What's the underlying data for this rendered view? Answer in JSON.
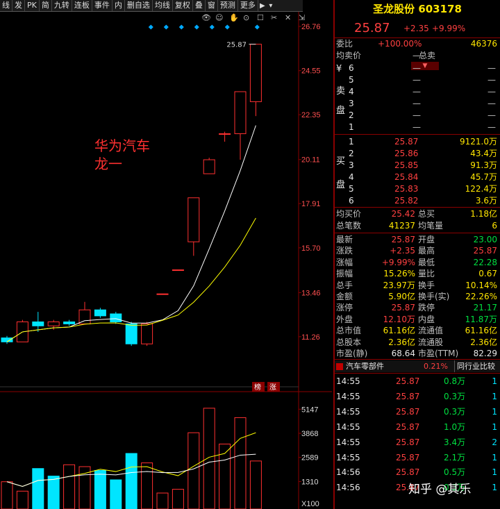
{
  "toolbar": {
    "items": [
      "线",
      "发",
      "PK",
      "简",
      "九转",
      "连板",
      "事件",
      "内",
      "删自选",
      "均线",
      "复权",
      "叠",
      "窗",
      "预测",
      "更多"
    ]
  },
  "annotation": {
    "line1": "华为汽车",
    "line2": "龙一"
  },
  "price_axis": {
    "ticks": [
      "26.76",
      "24.55",
      "22.35",
      "20.11",
      "17.91",
      "15.70",
      "13.46",
      "11.26"
    ]
  },
  "volume_axis": {
    "ticks": [
      "5147",
      "3868",
      "2589",
      "1310",
      "X100"
    ]
  },
  "max_label": "25.87",
  "badges": {
    "b1": "榜",
    "b2": "涨"
  },
  "stock": {
    "name": "圣龙股份",
    "code": "603178",
    "price": "25.87",
    "change": "+2.35",
    "pct": "+9.99%"
  },
  "weibi": {
    "label": "委比",
    "value": "+100.00%",
    "diff": "46376"
  },
  "sell_header": {
    "avg_label": "均卖价",
    "avg_value": "—",
    "total_label": "总卖"
  },
  "sell_side_label": [
    "¥",
    "卖",
    "盘"
  ],
  "sell_orders": [
    {
      "lvl": "6",
      "p": "—",
      "v": "—"
    },
    {
      "lvl": "5",
      "p": "—",
      "v": "—"
    },
    {
      "lvl": "4",
      "p": "—",
      "v": "—"
    },
    {
      "lvl": "3",
      "p": "—",
      "v": "—"
    },
    {
      "lvl": "2",
      "p": "—",
      "v": "—"
    },
    {
      "lvl": "1",
      "p": "—",
      "v": "—"
    }
  ],
  "buy_side_label": [
    "买",
    "盘"
  ],
  "buy_orders": [
    {
      "lvl": "1",
      "p": "25.87",
      "v": "9121.0万"
    },
    {
      "lvl": "2",
      "p": "25.86",
      "v": "43.4万"
    },
    {
      "lvl": "3",
      "p": "25.85",
      "v": "91.3万"
    },
    {
      "lvl": "4",
      "p": "25.84",
      "v": "45.7万"
    },
    {
      "lvl": "5",
      "p": "25.83",
      "v": "122.4万"
    },
    {
      "lvl": "6",
      "p": "25.82",
      "v": "3.6万"
    }
  ],
  "summary1": [
    {
      "l": "均买价",
      "lv": "25.42",
      "r": "总买",
      "rv": "1.18亿"
    },
    {
      "l": "总笔数",
      "lv": "41237",
      "r": "均笔量",
      "rv": "6"
    }
  ],
  "stats": [
    {
      "l": "最新",
      "lv": "25.87",
      "lc": "r",
      "r": "开盘",
      "rv": "23.00",
      "rc": "g"
    },
    {
      "l": "涨跌",
      "lv": "+2.35",
      "lc": "r",
      "r": "最高",
      "rv": "25.87",
      "rc": "r"
    },
    {
      "l": "涨幅",
      "lv": "+9.99%",
      "lc": "r",
      "r": "最低",
      "rv": "22.28",
      "rc": "g"
    },
    {
      "l": "振幅",
      "lv": "15.26%",
      "lc": "y",
      "r": "量比",
      "rv": "0.67",
      "rc": "y"
    },
    {
      "l": "总手",
      "lv": "23.97万",
      "lc": "y",
      "r": "换手",
      "rv": "10.14%",
      "rc": "y"
    },
    {
      "l": "金额",
      "lv": "5.90亿",
      "lc": "y",
      "r": "换手(实)",
      "rv": "22.26%",
      "rc": "y"
    },
    {
      "l": "涨停",
      "lv": "25.87",
      "lc": "r",
      "r": "跌停",
      "rv": "21.17",
      "rc": "g"
    },
    {
      "l": "外盘",
      "lv": "12.10万",
      "lc": "r",
      "r": "内盘",
      "rv": "11.87万",
      "rc": "g"
    },
    {
      "l": "总市值",
      "lv": "61.16亿",
      "lc": "y",
      "r": "流通值",
      "rv": "61.16亿",
      "rc": "y"
    },
    {
      "l": "总股本",
      "lv": "2.36亿",
      "lc": "y",
      "r": "流通股",
      "rv": "2.36亿",
      "rc": "y"
    },
    {
      "l": "市盈(静)",
      "lv": "68.64",
      "lc": "w",
      "r": "市盈(TTM)",
      "rv": "82.29",
      "rc": "w"
    }
  ],
  "sector": {
    "name": "汽车零部件",
    "pct": "0.21%",
    "compare": "同行业比较"
  },
  "ticks": [
    {
      "t": "14:55",
      "p": "25.87",
      "v": "0.8万",
      "n": "1"
    },
    {
      "t": "14:55",
      "p": "25.87",
      "v": "0.3万",
      "n": "1"
    },
    {
      "t": "14:55",
      "p": "25.87",
      "v": "0.3万",
      "n": "1"
    },
    {
      "t": "14:55",
      "p": "25.87",
      "v": "1.0万",
      "n": "1"
    },
    {
      "t": "14:55",
      "p": "25.87",
      "v": "3.4万",
      "n": "2"
    },
    {
      "t": "14:55",
      "p": "25.87",
      "v": "2.1万",
      "n": "1"
    },
    {
      "t": "14:56",
      "p": "25.87",
      "v": "0.5万",
      "n": "1"
    },
    {
      "t": "14:56",
      "p": "25.87",
      "v": "0.3万",
      "n": "1"
    }
  ],
  "watermark": "知乎 @其乐",
  "candles": [
    {
      "o": 11.2,
      "c": 11.0,
      "h": 11.3,
      "l": 10.9
    },
    {
      "o": 11.0,
      "c": 12.0,
      "h": 12.1,
      "l": 11.0
    },
    {
      "o": 12.0,
      "c": 11.8,
      "h": 12.5,
      "l": 11.5
    },
    {
      "o": 11.8,
      "c": 12.0,
      "h": 12.1,
      "l": 11.6
    },
    {
      "o": 12.0,
      "c": 11.9,
      "h": 12.1,
      "l": 11.8
    },
    {
      "o": 11.9,
      "c": 12.6,
      "h": 13.0,
      "l": 11.9
    },
    {
      "o": 12.6,
      "c": 12.3,
      "h": 12.7,
      "l": 12.2
    },
    {
      "o": 12.4,
      "c": 12.0,
      "h": 12.5,
      "l": 11.9
    },
    {
      "o": 11.9,
      "c": 10.9,
      "h": 12.0,
      "l": 10.8
    },
    {
      "o": 10.9,
      "c": 11.9,
      "h": 12.0,
      "l": 10.8
    },
    {
      "o": 13.4,
      "c": 13.4,
      "h": 13.4,
      "l": 13.4
    },
    {
      "o": 14.6,
      "c": 14.6,
      "h": 14.6,
      "l": 14.6
    },
    {
      "o": 16.0,
      "c": 18.2,
      "h": 18.2,
      "l": 15.3
    },
    {
      "o": 19.4,
      "c": 20.1,
      "h": 20.2,
      "l": 19.4
    },
    {
      "o": 21.4,
      "c": 21.4,
      "h": 21.5,
      "l": 21.0
    },
    {
      "o": 21.4,
      "c": 23.5,
      "h": 23.5,
      "l": 20.1
    },
    {
      "o": 23.0,
      "c": 25.87,
      "h": 25.87,
      "l": 22.28
    }
  ],
  "volumes": [
    {
      "v": 1300,
      "up": true
    },
    {
      "v": 800,
      "up": true
    },
    {
      "v": 2000,
      "up": false
    },
    {
      "v": 1600,
      "up": false
    },
    {
      "v": 2200,
      "up": true
    },
    {
      "v": 2100,
      "up": true
    },
    {
      "v": 1900,
      "up": false
    },
    {
      "v": 1400,
      "up": false
    },
    {
      "v": 2800,
      "up": false
    },
    {
      "v": 2300,
      "up": true
    },
    {
      "v": 700,
      "up": true
    },
    {
      "v": 900,
      "up": true
    },
    {
      "v": 3900,
      "up": true
    },
    {
      "v": 5200,
      "up": true
    },
    {
      "v": 3300,
      "up": true
    },
    {
      "v": 4700,
      "up": true
    },
    {
      "v": 2400,
      "up": true
    }
  ],
  "colors": {
    "up": "#ff3030",
    "down": "#00e5ff",
    "ma1": "#ffffff",
    "ma2": "#ffff00",
    "grid": "#8b0000"
  }
}
